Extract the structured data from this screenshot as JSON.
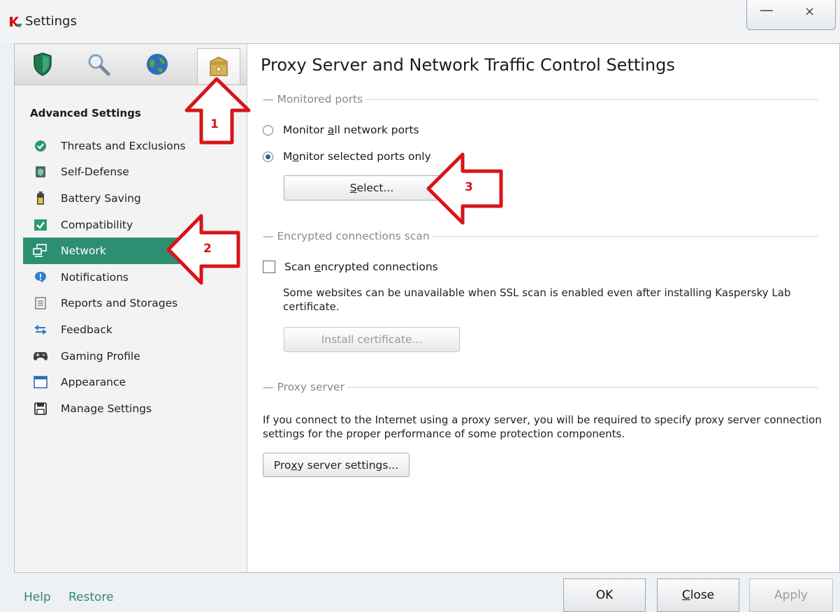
{
  "window": {
    "title": "Settings",
    "logo_icon": "kaspersky-logo",
    "minimize_symbol": "—",
    "close_symbol": "×"
  },
  "toolbar": {
    "icons": [
      "shield-icon",
      "magnifier-icon",
      "globe-icon",
      "toolbox-icon"
    ],
    "selected_index": 3
  },
  "sidebar": {
    "heading": "Advanced Settings",
    "items": [
      {
        "label": "Threats and Exclusions",
        "icon": "checkmark-circle-icon"
      },
      {
        "label": "Self-Defense",
        "icon": "shield-small-icon"
      },
      {
        "label": "Battery Saving",
        "icon": "battery-icon"
      },
      {
        "label": "Compatibility",
        "icon": "check-box-icon"
      },
      {
        "label": "Network",
        "icon": "network-icon"
      },
      {
        "label": "Notifications",
        "icon": "notification-icon"
      },
      {
        "label": "Reports and Storages",
        "icon": "report-icon"
      },
      {
        "label": "Feedback",
        "icon": "feedback-arrows-icon"
      },
      {
        "label": "Gaming Profile",
        "icon": "gamepad-icon"
      },
      {
        "label": "Appearance",
        "icon": "window-icon"
      },
      {
        "label": "Manage Settings",
        "icon": "floppy-icon"
      }
    ],
    "active_index": 4
  },
  "main": {
    "title": "Proxy Server and Network Traffic Control Settings",
    "monitored_ports": {
      "header": "Monitored ports",
      "option_all_pre": "Monitor ",
      "option_all_u": "a",
      "option_all_post": "ll network ports",
      "option_selected_pre": "M",
      "option_selected_u": "o",
      "option_selected_post": "nitor selected ports only",
      "selected_option": "selected",
      "select_button_u": "S",
      "select_button_post": "elect..."
    },
    "encrypted": {
      "header": "Encrypted connections scan",
      "checkbox_pre": "Scan ",
      "checkbox_u": "e",
      "checkbox_post": "ncrypted connections",
      "checked": false,
      "note": "Some websites can be unavailable when SSL scan is enabled even after installing Kaspersky Lab certificate.",
      "install_button": "Install certificate..."
    },
    "proxy": {
      "header": "Proxy server",
      "note": "If you connect to the Internet using a proxy server, you will be required to specify proxy server connection settings for the proper performance of some protection components.",
      "button_pre": "Pro",
      "button_u": "x",
      "button_post": "y server settings..."
    }
  },
  "footer": {
    "help": "Help",
    "restore": "Restore",
    "ok": "OK",
    "close_u": "C",
    "close_post": "lose",
    "apply": "Apply"
  },
  "annotations": {
    "color": "#d8141a",
    "labels": [
      "1",
      "2",
      "3"
    ]
  },
  "colors": {
    "accent_green": "#2d8f72",
    "link_green": "#2e8a6c"
  }
}
